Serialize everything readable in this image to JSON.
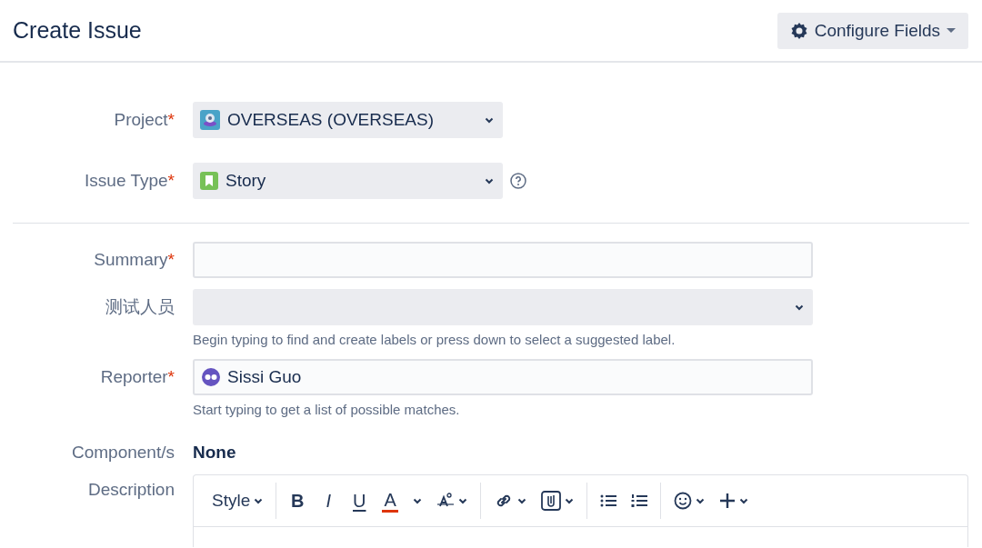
{
  "header": {
    "title": "Create Issue",
    "configure_button": "Configure Fields"
  },
  "top_fields": [
    {
      "kind": "project",
      "label": "Project",
      "required_mark": "*",
      "value": "OVERSEAS (OVERSEAS)"
    },
    {
      "kind": "issue-type",
      "label": "Issue Type",
      "required_mark": "*",
      "value": "Story"
    }
  ],
  "fields": [
    {
      "kind": "text",
      "label": "Summary",
      "required_mark": "*"
    },
    {
      "kind": "labels",
      "label": "测试人员",
      "hint": "Begin typing to find and create labels or press down to select a suggested label."
    },
    {
      "kind": "user",
      "label": "Reporter",
      "required_mark": "*",
      "value": "Sissi Guo",
      "hint": "Start typing to get a list of possible matches."
    },
    {
      "kind": "static",
      "label": "Component/s",
      "value": "None"
    },
    {
      "kind": "editor",
      "label": "Description"
    }
  ],
  "toolbar": [
    [
      {
        "kind": "style",
        "label": "Style"
      }
    ],
    [
      {
        "kind": "bold",
        "label": "B"
      },
      {
        "kind": "italic",
        "label": "I"
      },
      {
        "kind": "underline",
        "label": "U"
      },
      {
        "kind": "color",
        "label": "A"
      },
      {
        "kind": "textsize"
      }
    ],
    [
      {
        "kind": "link"
      },
      {
        "kind": "attachment"
      }
    ],
    [
      {
        "kind": "bullets"
      },
      {
        "kind": "numbers"
      }
    ],
    [
      {
        "kind": "emoji"
      },
      {
        "kind": "insert"
      }
    ]
  ]
}
